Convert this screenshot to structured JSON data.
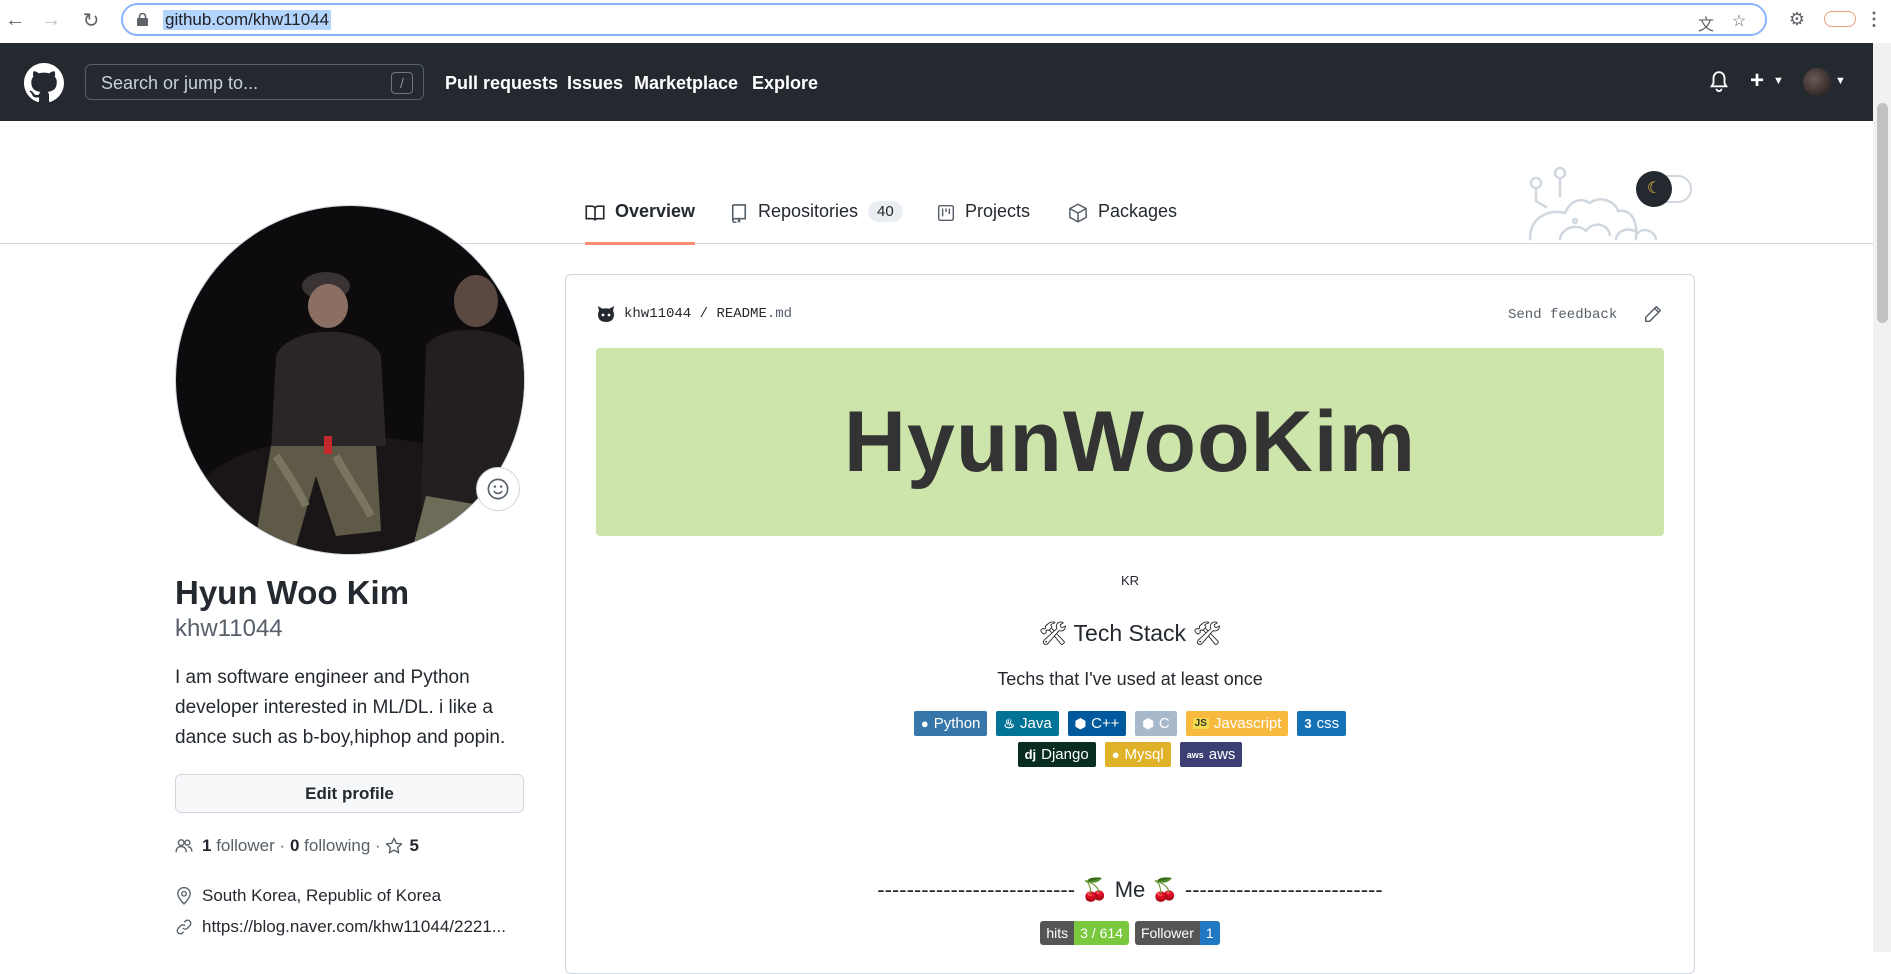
{
  "browser": {
    "url": "github.com/khw11044"
  },
  "header": {
    "search_placeholder": "Search or jump to...",
    "slash_key": "/",
    "nav": [
      "Pull requests",
      "Issues",
      "Marketplace",
      "Explore"
    ]
  },
  "tabs": [
    {
      "label": "Overview",
      "icon": "book-icon",
      "selected": true
    },
    {
      "label": "Repositories",
      "icon": "repo-icon",
      "count": "40"
    },
    {
      "label": "Projects",
      "icon": "project-icon"
    },
    {
      "label": "Packages",
      "icon": "package-icon"
    }
  ],
  "profile": {
    "full_name": "Hyun Woo Kim",
    "login": "khw11044",
    "bio": "I am software engineer and Python developer interested in ML/DL. i like a dance such as b-boy,hiphop and popin.",
    "edit_label": "Edit profile",
    "followers_count": "1",
    "followers_label": "follower",
    "following_count": "0",
    "following_label": "following",
    "separator": "·",
    "stars_count": "5",
    "location": "South Korea, Republic of Korea",
    "link": "https://blog.naver.com/khw11044/2221..."
  },
  "readme": {
    "owner": "khw11044",
    "path_sep": "/",
    "file": "README",
    "ext": ".md",
    "feedback": "Send feedback",
    "banner_title": "HyunWooKim",
    "lang_label": "KR",
    "tech_title": "🛠 Tech Stack 🛠",
    "tech_sub": "Techs that I've used at least once",
    "badges_row1": [
      {
        "label": "Python",
        "color": "#3776ab",
        "icon": "python-icon"
      },
      {
        "label": "Java",
        "color": "#007396",
        "icon": "java-icon"
      },
      {
        "label": "C++",
        "color": "#00599c",
        "icon": "cpp-icon"
      },
      {
        "label": "C",
        "color": "#a8b9cc",
        "icon": "c-icon"
      },
      {
        "label": "Javascript",
        "color": "#f7b93e",
        "icon": "javascript-icon"
      },
      {
        "label": "css",
        "color": "#1572b6",
        "icon": "css3-icon"
      }
    ],
    "badges_row2": [
      {
        "label": "Django",
        "color": "#092e20",
        "icon": "django-icon"
      },
      {
        "label": "Mysql",
        "color": "#e0b229",
        "icon": "mysql-icon"
      },
      {
        "label": "aws",
        "color": "#3b3f73",
        "icon": "aws-icon"
      }
    ],
    "me_heading": "--------------------------- 🍒 Me 🍒 ---------------------------",
    "hits_label": "hits",
    "hits_value": "3 / 614",
    "follower_label": "Follower",
    "follower_value": "1"
  }
}
